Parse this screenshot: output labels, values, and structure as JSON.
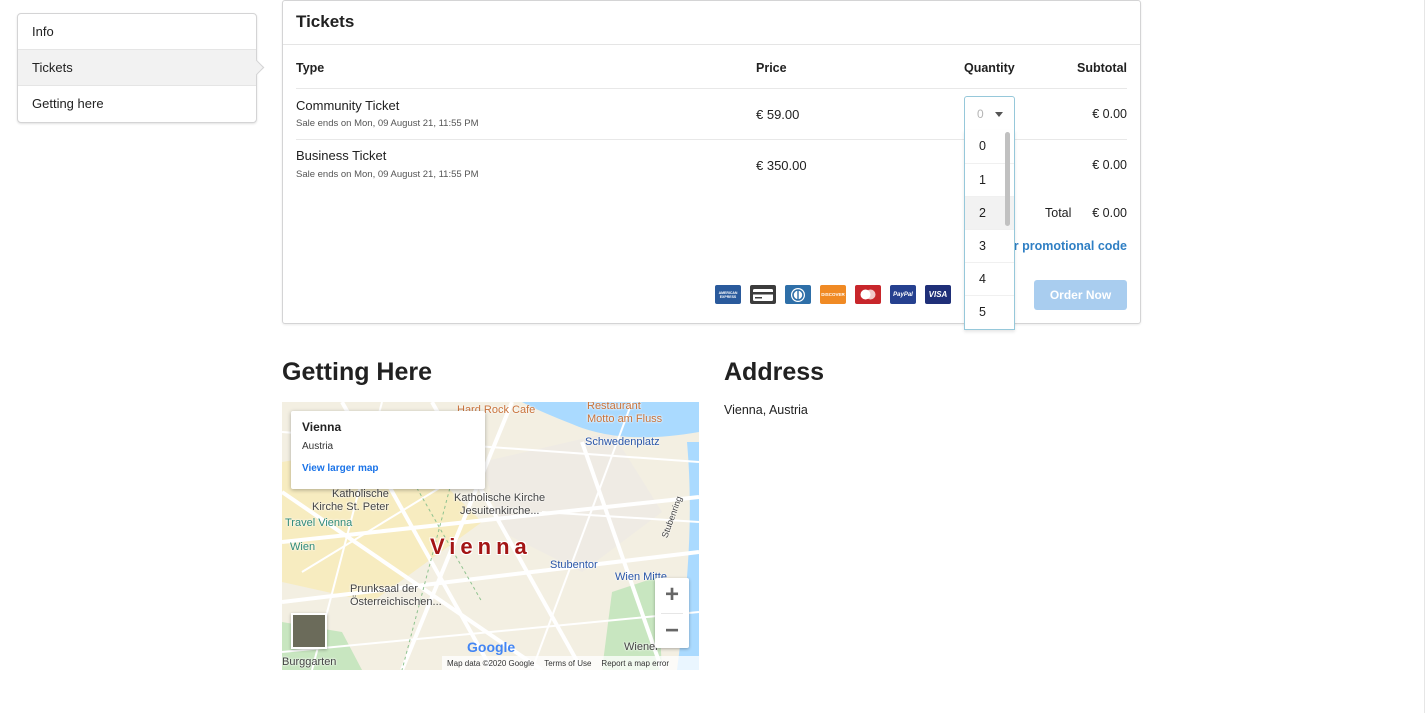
{
  "sidebar": {
    "items": [
      {
        "label": "Info",
        "active": false
      },
      {
        "label": "Tickets",
        "active": true
      },
      {
        "label": "Getting here",
        "active": false
      }
    ]
  },
  "tickets": {
    "title": "Tickets",
    "columns": {
      "type": "Type",
      "price": "Price",
      "quantity": "Quantity",
      "subtotal": "Subtotal"
    },
    "rows": [
      {
        "name": "Community Ticket",
        "sale_ends": "Sale ends on Mon, 09 August 21, 11:55 PM",
        "price": "€ 59.00",
        "subtotal": "€ 0.00"
      },
      {
        "name": "Business Ticket",
        "sale_ends": "Sale ends on Mon, 09 August 21, 11:55 PM",
        "price": "€ 350.00",
        "subtotal": "€ 0.00"
      }
    ],
    "total_label": "Total",
    "total_value": "€ 0.00",
    "promo_link": "ter promotional code",
    "order_button": "Order Now",
    "payment_icons": [
      "amex-icon",
      "card-icon",
      "diners-icon",
      "discover-icon",
      "mastercard-icon",
      "paypal-icon",
      "visa-icon"
    ],
    "payment_labels": {
      "amex": "AMERICAN EXPRESS",
      "paypal": "PayPal",
      "visa": "VISA",
      "discover": "DISCOVER"
    }
  },
  "quantity_dropdown": {
    "selected": "0",
    "options": [
      "0",
      "1",
      "2",
      "3",
      "4",
      "5"
    ],
    "hovered": "2"
  },
  "getting_here": {
    "heading": "Getting Here",
    "map": {
      "info_title": "Vienna",
      "info_country": "Austria",
      "larger_map_link": "View larger map",
      "city_label": "Vienna",
      "labels": {
        "hard_rock": "Hard Rock Cafe",
        "restaurant": "Restaurant",
        "motto": "Motto am Fluss",
        "schwedenplatz": "Schwedenplatz",
        "katholische_1": "Katholische",
        "kirche_peter": "Kirche St. Peter",
        "jesuiten": "Katholische Kirche",
        "jesuiten_2": "Jesuitenkirche...",
        "travel": "Travel Vienna",
        "wien": "Wien",
        "stubentor": "Stubentor",
        "wien_mitte": "Wien Mitte",
        "prunksaal": "Prunksaal der",
        "oesterreich": "Österreichischen...",
        "burggarten": "Burggarten",
        "wiener": "Wiener",
        "stubenring": "Stubenring"
      },
      "zoom_in": "+",
      "zoom_out": "−",
      "google": "Google",
      "footer_data": "Map data ©2020 Google",
      "footer_terms": "Terms of Use",
      "footer_report": "Report a map error"
    }
  },
  "address": {
    "heading": "Address",
    "text": "Vienna, Austria"
  },
  "colors": {
    "accent": "#2f7fc4",
    "order_button_disabled": "#a9cdef",
    "dropdown_border": "#96c8da",
    "city_label": "#a31515"
  }
}
